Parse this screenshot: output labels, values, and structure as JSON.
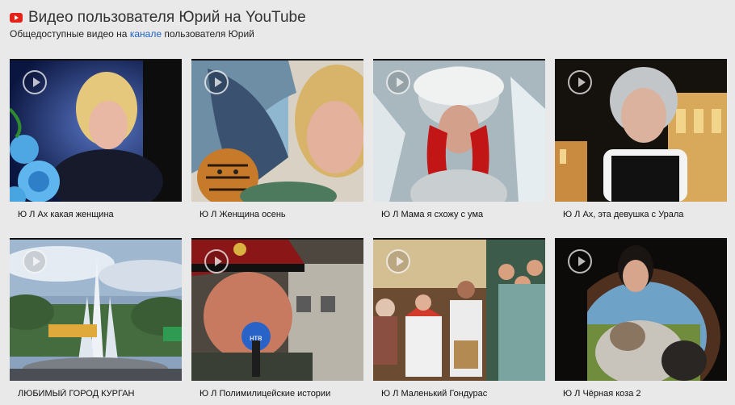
{
  "header": {
    "icon": "youtube-icon",
    "title": "Видео пользователя Юрий на YouTube",
    "subtitle_before": "Общедоступные видео на ",
    "subtitle_link": "канале",
    "subtitle_after": " пользователя Юрий"
  },
  "videos": [
    {
      "title": "Ю Л Ах какая женщина"
    },
    {
      "title": "Ю Л Женщина осень"
    },
    {
      "title": "Ю Л Мама я схожу с ума"
    },
    {
      "title": "Ю Л Ах, эта девушка с Урала"
    },
    {
      "title": "ЛЮБИМЫЙ ГОРОД КУРГАН"
    },
    {
      "title": "Ю Л Полимилицейские истории"
    },
    {
      "title": "Ю Л Маленький Гондурас"
    },
    {
      "title": "Ю Л Чёрная коза 2"
    }
  ],
  "colors": {
    "background": "#e9e9e9",
    "link": "#1f63c7",
    "youtube_red": "#e62117"
  }
}
